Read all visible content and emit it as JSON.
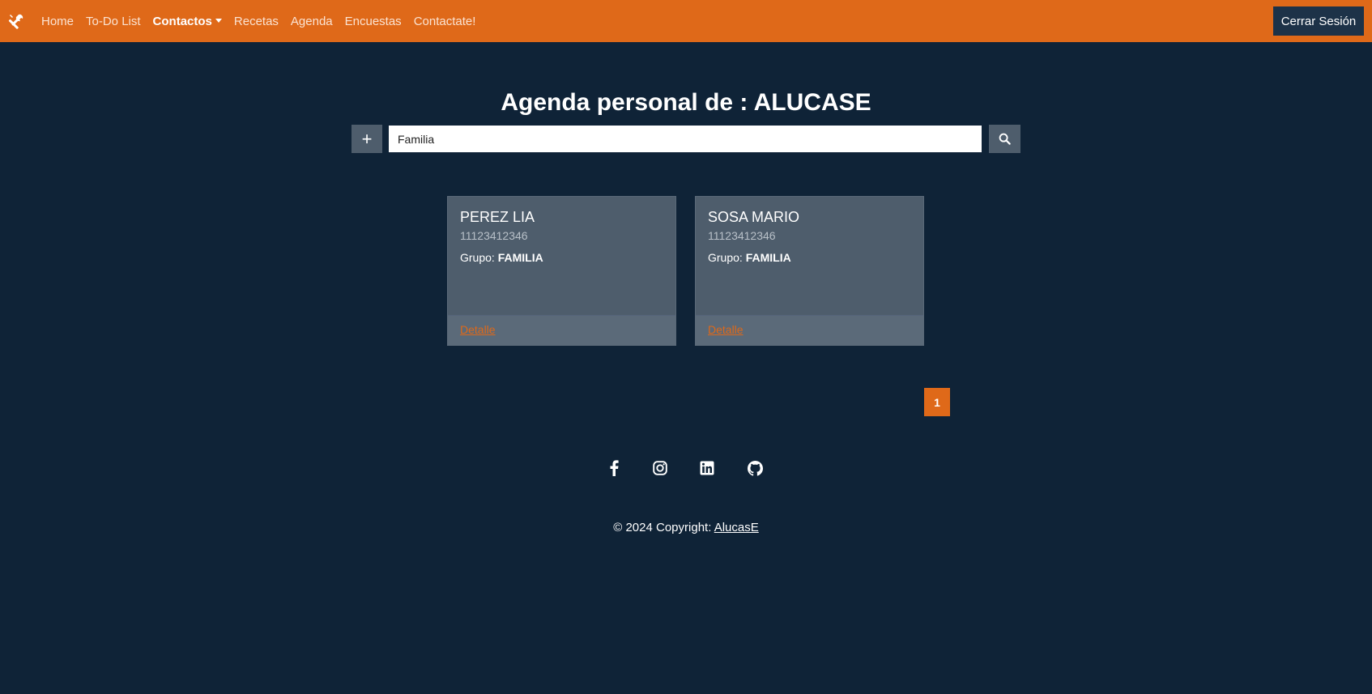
{
  "navbar": {
    "brand_icon": "tools-icon",
    "links": [
      {
        "label": "Home"
      },
      {
        "label": "To-Do List"
      },
      {
        "label": "Contactos"
      },
      {
        "label": "Recetas"
      },
      {
        "label": "Agenda"
      },
      {
        "label": "Encuestas"
      },
      {
        "label": "Contactate!"
      }
    ],
    "logout_label": "Cerrar Sesión",
    "color": "#df6919"
  },
  "header": {
    "title": "Agenda personal de : ALUCASE"
  },
  "search": {
    "add_label": "+",
    "value": "Familia",
    "search_icon": "search-icon"
  },
  "contacts": [
    {
      "name": "PEREZ LIA",
      "phone": "11123412346",
      "group_label": "Grupo:",
      "group": "FAMILIA",
      "link": "Detalle"
    },
    {
      "name": "SOSA MARIO",
      "phone": "11123412346",
      "group_label": "Grupo:",
      "group": "FAMILIA",
      "link": "Detalle"
    }
  ],
  "pagination": {
    "current": "1"
  },
  "social_icons": [
    "facebook-icon",
    "instagram-icon",
    "linkedin-icon",
    "github-icon"
  ],
  "footer": {
    "copyright_prefix": "© 2024 Copyright: ",
    "copyright_link": "AlucasE"
  },
  "colors": {
    "background": "#0f2337",
    "accent": "#df6919",
    "card": "#4e5d6c"
  }
}
